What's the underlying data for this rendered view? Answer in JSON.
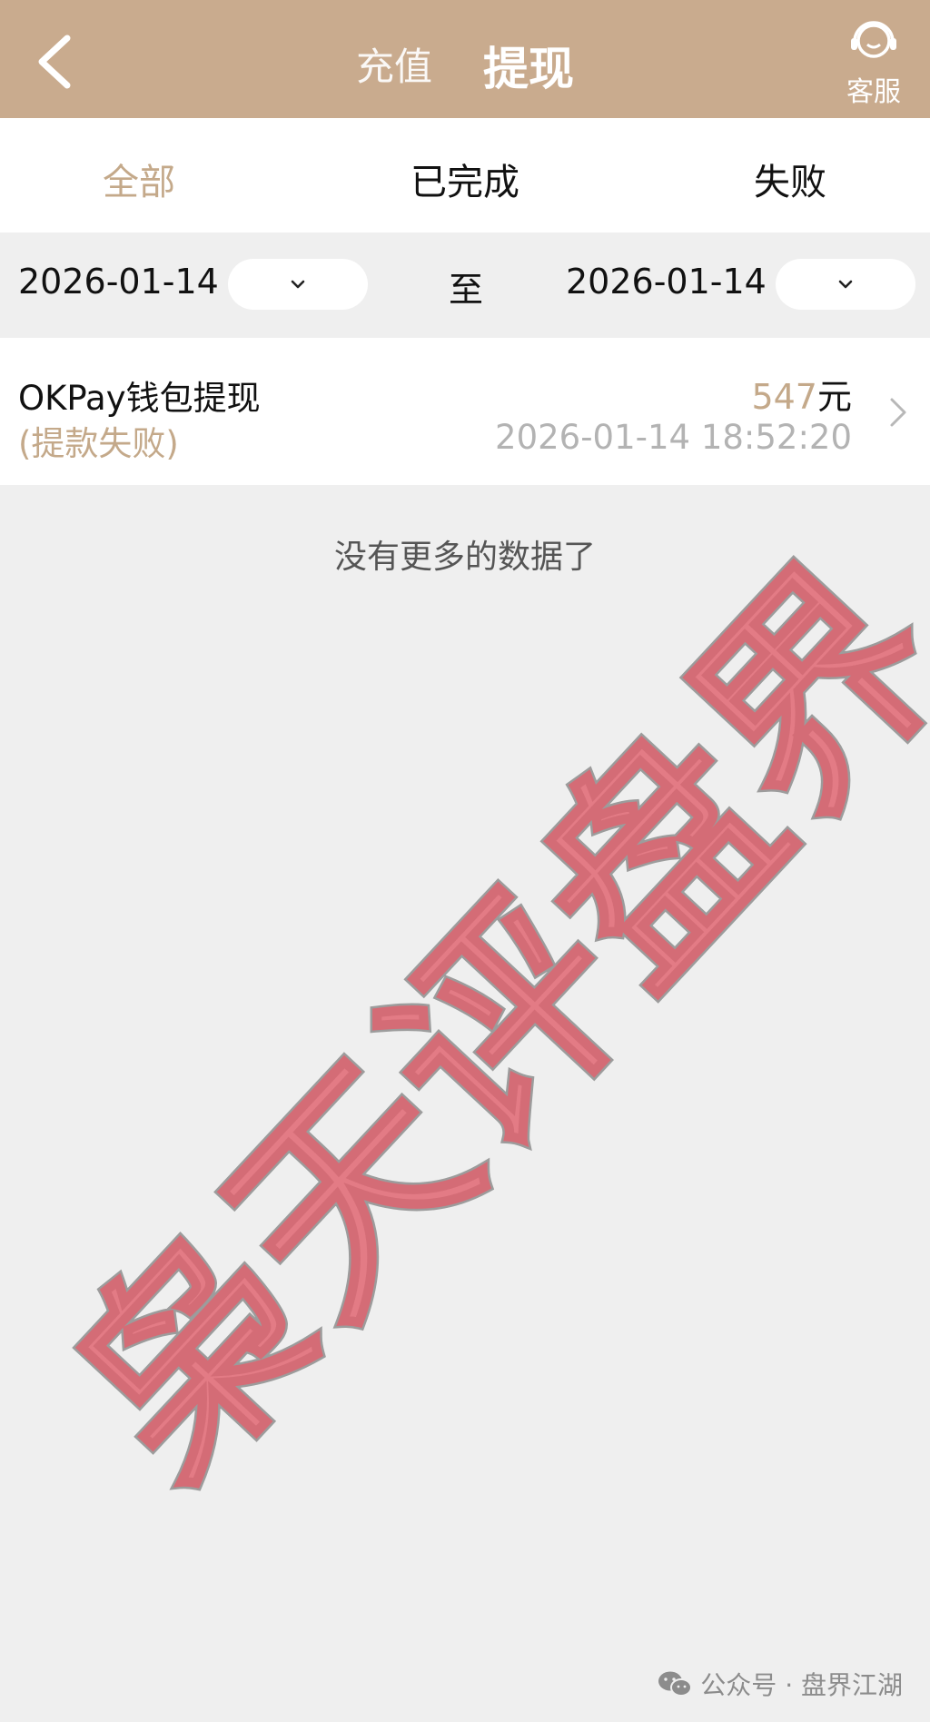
{
  "header": {
    "tabs": [
      {
        "label": "充值",
        "active": false
      },
      {
        "label": "提现",
        "active": true
      }
    ],
    "service_label": "客服",
    "bg_color": "#c9ab8e"
  },
  "filter_tabs": [
    {
      "label": "全部",
      "active": true
    },
    {
      "label": "已完成",
      "active": false
    },
    {
      "label": "失败",
      "active": false
    }
  ],
  "date_range": {
    "start": "2026-01-14",
    "separator": "至",
    "end": "2026-01-14"
  },
  "records": [
    {
      "title": "OKPay钱包提现",
      "status": "(提款失败)",
      "amount": "547",
      "unit": "元",
      "time": "2026-01-14 18:52:20"
    }
  ],
  "no_more_text": "没有更多的数据了",
  "watermark": {
    "text": "枭天评盘界",
    "color": "#e0626e"
  },
  "credit": {
    "source": "公众号 · 盘界江湖"
  },
  "colors": {
    "accent": "#c4a98a",
    "background": "#efefef"
  }
}
